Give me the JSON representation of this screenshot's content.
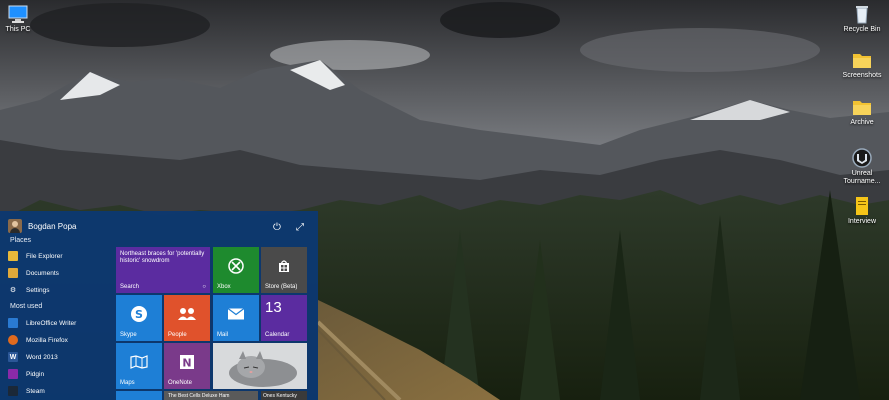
{
  "desktop": {
    "icons": [
      {
        "label": "This PC"
      },
      {
        "label": "Recycle Bin"
      },
      {
        "label": "Screenshots"
      },
      {
        "label": "Archive"
      },
      {
        "label": "Unreal Tourname..."
      },
      {
        "label": "Interview"
      }
    ]
  },
  "start_menu": {
    "user_name": "Bogdan Popa",
    "places_title": "Places",
    "places": [
      {
        "label": "File Explorer"
      },
      {
        "label": "Documents"
      },
      {
        "label": "Settings"
      }
    ],
    "most_used_title": "Most used",
    "most_used": [
      {
        "label": "LibreOffice Writer"
      },
      {
        "label": "Mozilla Firefox"
      },
      {
        "label": "Word 2013"
      },
      {
        "label": "Pidgin"
      },
      {
        "label": "Steam"
      }
    ],
    "tiles": {
      "search_news": "Northeast braces for 'potentially historic' snowdrom",
      "search_label": "Search",
      "xbox": "Xbox",
      "store": "Store (Beta)",
      "skype": "Skype",
      "people": "People",
      "mail": "Mail",
      "calendar_label": "Calendar",
      "calendar_day": "13",
      "maps": "Maps",
      "onenote": "OneNote",
      "bottom_1": "The Best Cells Deluxe Ham",
      "bottom_2": "Ones Kentucky"
    }
  },
  "colors": {
    "start_menu_bg": "#0c3870",
    "tile_purple": "#5b2ca0",
    "tile_green": "#1e8a2e",
    "tile_grey": "#4a4a4a",
    "tile_blue": "#1e7fd6",
    "tile_orange": "#e0522c",
    "tile_onenote": "#7a3a8a"
  }
}
